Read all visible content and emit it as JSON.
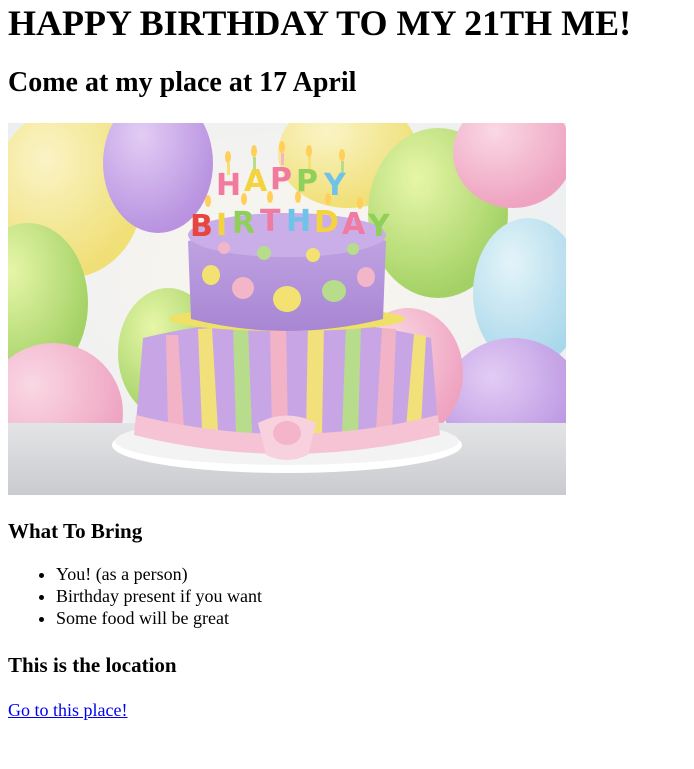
{
  "header": {
    "title": "HAPPY BIRTHDAY TO MY 21TH ME!",
    "subtitle": "Come at my place at 17 April"
  },
  "image": {
    "subject": "birthday-cake-with-balloons",
    "cake_letters": "HAPPY BIRTHDAY",
    "colors": {
      "cake_top": "#b79ad8",
      "cake_bottom": "#c8a6e6",
      "stripe_pink": "#f2b3c6",
      "stripe_yellow": "#f2e07a",
      "stripe_green": "#b7dc8c",
      "ribbon": "#f5c3d3"
    }
  },
  "bring_section": {
    "heading": "What To Bring",
    "items": [
      "You! (as a person)",
      "Birthday present if you want",
      "Some food will be great"
    ]
  },
  "location_section": {
    "heading": "This is the location",
    "link_text": "Go to this place!"
  },
  "colors": {
    "link": "#0000ee",
    "text": "#000000",
    "background": "#ffffff"
  }
}
